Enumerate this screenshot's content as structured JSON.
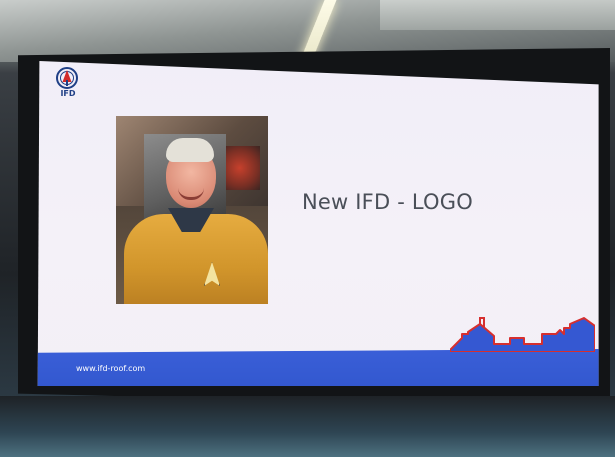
{
  "slide": {
    "title": "New IFD - LOGO",
    "logo_text": "IFD",
    "footer_url": "www.ifd-roof.com"
  },
  "colors": {
    "slide_background": "#f3f0f7",
    "footer_bar": "#3558d2",
    "logo_blue": "#1f3f86",
    "logo_red": "#d32a2a",
    "house_outline": "#d62f2f",
    "house_fill": "#3558d2",
    "title_text": "#4a4f58",
    "shirt_gold": "#d9a13a"
  },
  "icons": {
    "logo": "ifd-roof-logo-icon",
    "houses": "roofline-houses-icon",
    "insignia": "starfleet-insignia-icon"
  }
}
